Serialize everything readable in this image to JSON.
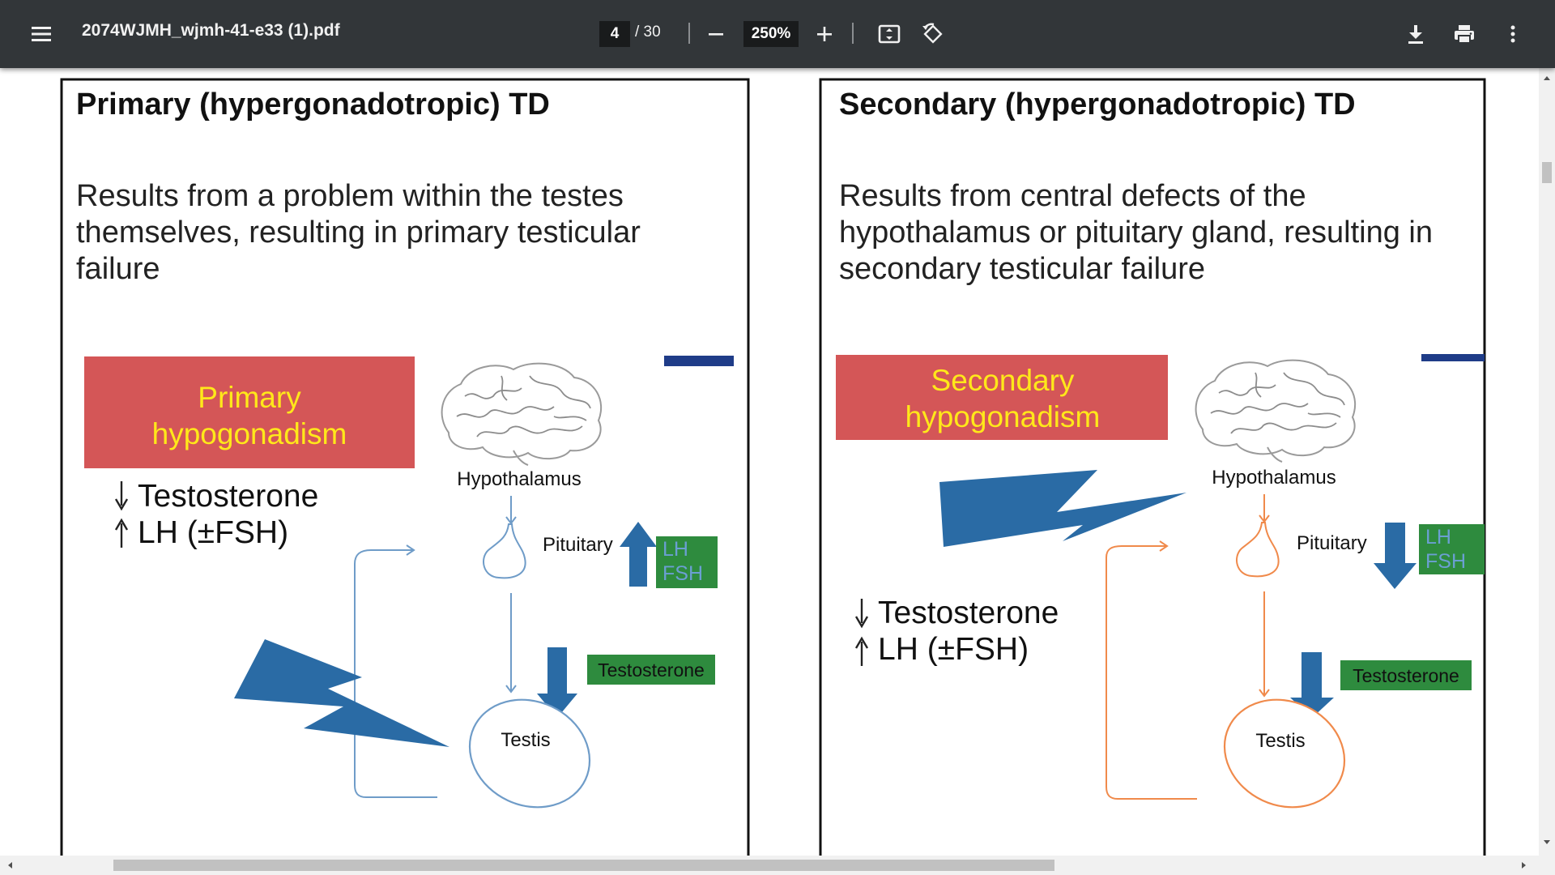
{
  "toolbar": {
    "menu_icon": "hamburger-menu-icon",
    "file_name": "2074WJMH_wjmh-41-e33 (1).pdf",
    "current_page": "4",
    "page_total": "/ 30",
    "zoom_level": "250%",
    "zoom_out_icon": "minus-icon",
    "zoom_in_icon": "plus-icon",
    "fit_icon": "fit-to-page-icon",
    "rotate_icon": "rotate-icon",
    "download_icon": "download-icon",
    "print_icon": "print-icon",
    "more_icon": "more-vertical-icon"
  },
  "colors": {
    "toolbar_bg": "#323639",
    "label_red": "#d45657",
    "label_text_yellow": "#ffe81a",
    "arrow_blue": "#2a6ba5",
    "hormone_green": "#2e8b3e",
    "primary_line_blue": "#6f9cc8",
    "secondary_line_orange": "#f08a4b",
    "navy_bar": "#1f3c88"
  },
  "document": {
    "primary": {
      "heading": "Primary (hypergonadotropic) TD",
      "description_lines": [
        "Results from a problem within the testes",
        "themselves, resulting in primary testicular",
        "failure"
      ],
      "label_lines": [
        "Primary",
        "hypogonadism"
      ],
      "effects": [
        "Testosterone",
        "LH (±FSH)"
      ],
      "hypothalamus": "Hypothalamus",
      "pituitary": "Pituitary",
      "lh": "LH",
      "fsh": "FSH",
      "testosterone_badge": "Testosterone",
      "testis": "Testis"
    },
    "secondary": {
      "heading": "Secondary (hypergonadotropic) TD",
      "description_lines": [
        "Results from central defects of the",
        "hypothalamus or pituitary gland, resulting in",
        "secondary testicular failure"
      ],
      "label_lines": [
        "Secondary",
        "hypogonadism"
      ],
      "effects": [
        "Testosterone",
        "LH (±FSH)"
      ],
      "hypothalamus": "Hypothalamus",
      "pituitary": "Pituitary",
      "lh": "LH",
      "fsh": "FSH",
      "testosterone_badge": "Testosterone",
      "testis": "Testis"
    }
  }
}
